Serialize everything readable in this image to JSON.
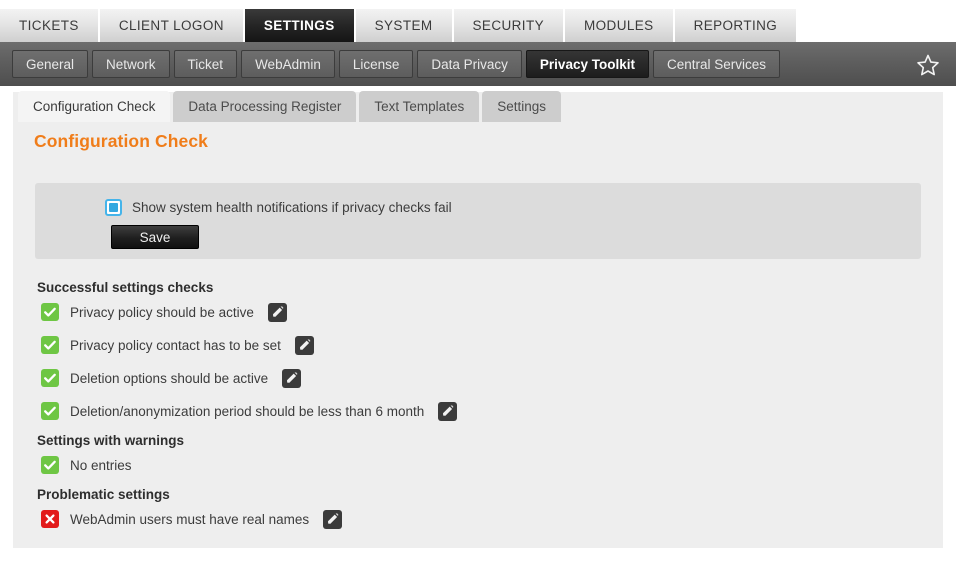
{
  "main_nav": {
    "items": [
      {
        "label": "TICKETS",
        "active": false
      },
      {
        "label": "CLIENT LOGON",
        "active": false
      },
      {
        "label": "SETTINGS",
        "active": true
      },
      {
        "label": "SYSTEM",
        "active": false
      },
      {
        "label": "SECURITY",
        "active": false
      },
      {
        "label": "MODULES",
        "active": false
      },
      {
        "label": "REPORTING",
        "active": false
      }
    ]
  },
  "sub_nav": {
    "items": [
      {
        "label": "General",
        "active": false
      },
      {
        "label": "Network",
        "active": false
      },
      {
        "label": "Ticket",
        "active": false
      },
      {
        "label": "WebAdmin",
        "active": false
      },
      {
        "label": "License",
        "active": false
      },
      {
        "label": "Data Privacy",
        "active": false
      },
      {
        "label": "Privacy Toolkit",
        "active": true
      },
      {
        "label": "Central Services",
        "active": false
      }
    ],
    "favorite_icon": "star-icon"
  },
  "inner_tabs": [
    {
      "label": "Configuration Check",
      "active": true
    },
    {
      "label": "Data Processing Register",
      "active": false
    },
    {
      "label": "Text Templates",
      "active": false
    },
    {
      "label": "Settings",
      "active": false
    }
  ],
  "page": {
    "title": "Configuration Check"
  },
  "notify_widget": {
    "checkbox_checked": true,
    "checkbox_label": "Show system health notifications if privacy checks fail",
    "save_label": "Save"
  },
  "check_groups": [
    {
      "title": "Successful settings checks",
      "rows": [
        {
          "status": "ok",
          "label": "Privacy policy should be active",
          "edit": true
        },
        {
          "status": "ok",
          "label": "Privacy policy contact has to be set",
          "edit": true
        },
        {
          "status": "ok",
          "label": "Deletion options should be active",
          "edit": true
        },
        {
          "status": "ok",
          "label": "Deletion/anonymization period should be less than 6 month",
          "edit": true
        }
      ]
    },
    {
      "title": "Settings with warnings",
      "rows": [
        {
          "status": "ok",
          "label": "No entries",
          "edit": false
        }
      ]
    },
    {
      "title": "Problematic settings",
      "rows": [
        {
          "status": "bad",
          "label": "WebAdmin users must have real names",
          "edit": true
        }
      ]
    }
  ],
  "colors": {
    "accent_orange": "#f07d1a",
    "status_ok_green": "#6ec644",
    "status_bad_red": "#e21b1b",
    "checkbox_blue": "#33a8e0",
    "panel_bg": "#eeeeee",
    "widget_bg": "#dcdcdc"
  }
}
